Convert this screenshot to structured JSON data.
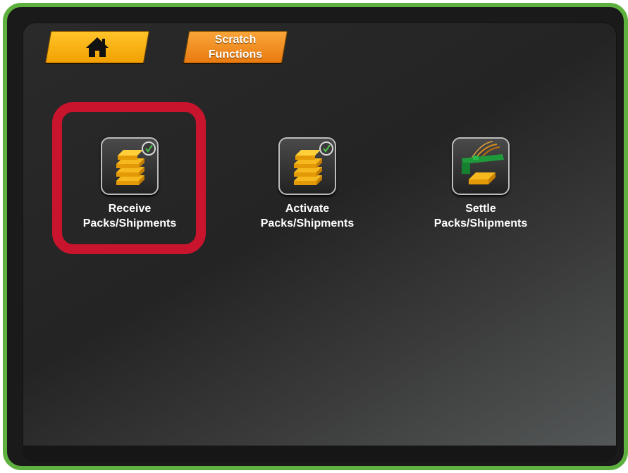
{
  "tabs": {
    "home_icon": "home-icon",
    "scratch_label": "Scratch\nFunctions"
  },
  "tiles": [
    {
      "label": "Receive\nPacks/Shipments",
      "icon": "books-check-icon"
    },
    {
      "label": "Activate\nPacks/Shipments",
      "icon": "books-check-icon"
    },
    {
      "label": "Settle\nPacks/Shipments",
      "icon": "book-scanner-icon"
    }
  ],
  "colors": {
    "frame_border": "#5fb13f",
    "highlight": "#c8142c",
    "tab_home": "#f2a000",
    "tab_scratch": "#e97a10",
    "book": "#f6b81c"
  }
}
